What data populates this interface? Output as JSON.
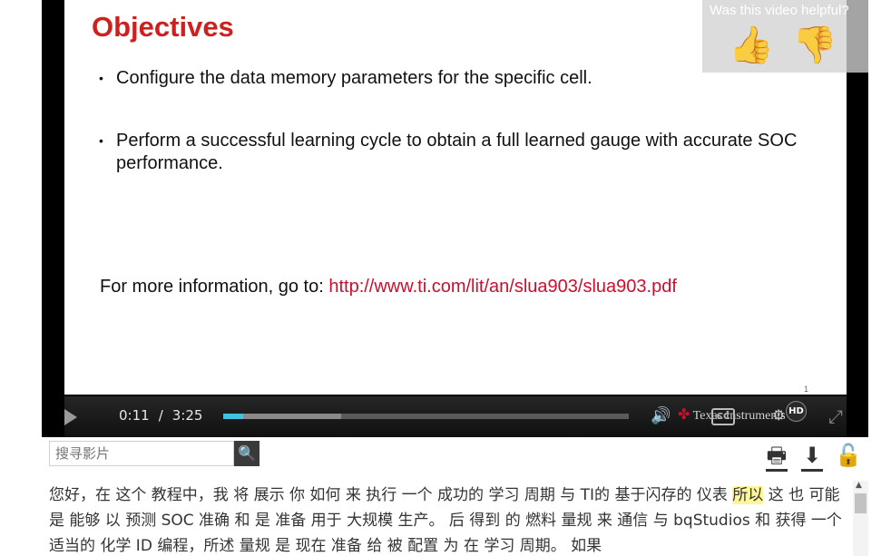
{
  "slide": {
    "title": "Objectives",
    "bullets": [
      "Configure the data memory parameters for the specific cell.",
      "Perform a successful learning cycle to obtain a full learned gauge with accurate SOC performance."
    ],
    "more_info_prefix": "For more information, go to: ",
    "more_info_link": "http://www.ti.com/lit/an/slua903/slua903.pdf",
    "slide_number": "1"
  },
  "feedback": {
    "label": "Was this video helpful?",
    "thumb_up_icon": "thumbs-up-icon",
    "thumb_down_icon": "thumbs-down-icon"
  },
  "player": {
    "current_time": "0:11",
    "separator": "/",
    "duration": "3:25",
    "played_fraction": 0.05,
    "buffered_fraction": 0.29,
    "brand": "Texas Instruments",
    "cc_label": "CC",
    "hd_label": "HD",
    "accent_color": "#3fc3e0"
  },
  "search": {
    "placeholder": "搜寻影片",
    "search_icon": "search-icon"
  },
  "toolbar": {
    "print_icon": "print-icon",
    "download_icon": "download-icon",
    "lock_icon": "lock-icon"
  },
  "transcript": {
    "text_before": "您好，在 这个 教程中，我 将 展示 你 如何 来 执行 一个 成功的 学习 周期 与 TI的 基于闪存的 仪表 ",
    "highlight": "所以",
    "text_after": " 这 也 可能 是 能够 以 预测 SOC 准确 和 是 准备 用于 大规模 生产。 后 得到 的 燃料 量规 来 通信 与 bqStudios 和 获得 一个 适当的 化学 ID 编程，所述 量规 是 现在 准备 给 被 配置 为 在 学习 周期。 如果",
    "highlight_color": "#fff59a"
  }
}
